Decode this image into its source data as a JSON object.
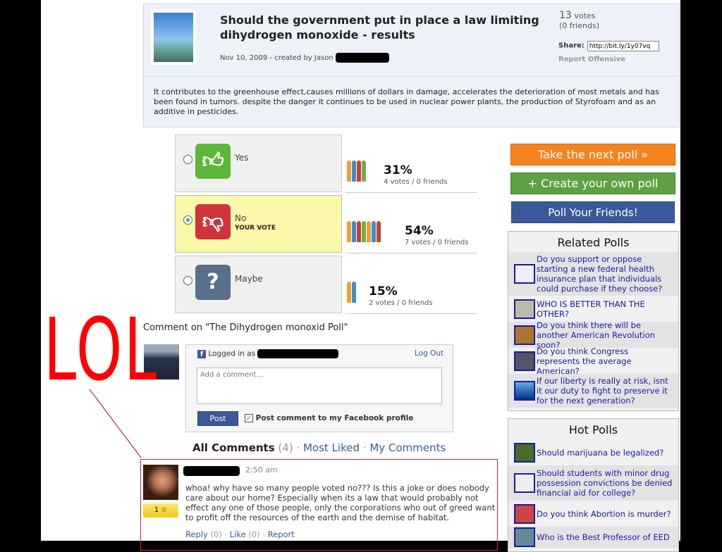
{
  "poll": {
    "title": "Should the government put in place a law limiting dihydrogen monoxide - results",
    "meta": "Nov 10, 2009 - created by Jason",
    "votes_count": "13",
    "votes_word": "votes",
    "friends": "(0 friends)",
    "share_label": "Share:",
    "share_url": "http://bit.ly/1y07vq",
    "report": "Report Offensive",
    "description": "It contributes to the greenhouse effect,causes millions of dollars in damage, accelerates the deterioration of most metals and has been found in tumors. despite the danger it continues to be used in nuclear power plants, the production of Styrofoam and as an additive in pesticides."
  },
  "options": [
    {
      "label": "Yes",
      "icon": "thumbs-up-icon",
      "color": "#5cb83a",
      "selected": false,
      "percent": "31%",
      "votes": "4 votes / 0 friends"
    },
    {
      "label": "No",
      "icon": "thumbs-down-icon",
      "color": "#d0343b",
      "selected": true,
      "your_vote": "YOUR VOTE",
      "percent": "54%",
      "votes": "7 votes / 0 friends"
    },
    {
      "label": "Maybe",
      "icon": "question-mark-icon",
      "color": "#5a6f8a",
      "selected": false,
      "percent": "15%",
      "votes": "2 votes / 0 friends"
    }
  ],
  "buttons": {
    "next": "Take the next poll »",
    "create": "+ Create your own poll",
    "friends": "Poll Your Friends!"
  },
  "related": {
    "title": "Related Polls",
    "items": [
      "Do you support or oppose starting a new federal health insurance plan that individuals could purchase if they choose?",
      "WHO IS BETTER THAN THE OTHER?",
      "Do you think there will be another American Revolution soon?",
      "Do you think Congress represents the average American?",
      "If our liberty is really at risk, isnt it our duty to fight to preserve it for the next generation?"
    ]
  },
  "hot": {
    "title": "Hot Polls",
    "items": [
      "Should marijuana be legalized?",
      "Should students with minor drug possession convictions be denied financial aid for college?",
      "Do you think Abortion is murder?",
      "Who is the Best Professor of EED"
    ]
  },
  "comments": {
    "heading": "Comment on \"The Dihydrogen monoxid Poll\"",
    "logged_in": "Logged in as",
    "logout": "Log Out",
    "placeholder": "Add a comment...",
    "post": "Post",
    "post_to_fb": "Post comment to my Facebook profile",
    "tab_all": "All Comments",
    "tab_count": "(4)",
    "tab_liked": "Most Liked",
    "tab_mine": "My Comments",
    "item": {
      "time": "2:50 am",
      "rating": "1",
      "text": "whoa! why have so many people voted no??? Is this a joke or does nobody care about our home? Especially when its a law that would probably not effect any one of those people, only the corporations who out of greed want to profit off the resources of the earth and the demise of habitat.",
      "reply": "Reply",
      "reply_count": "(0)",
      "like": "Like",
      "like_count": "(0)",
      "report": "Report"
    }
  },
  "annotation": {
    "text": "LOL",
    "color": "#ff0000"
  }
}
